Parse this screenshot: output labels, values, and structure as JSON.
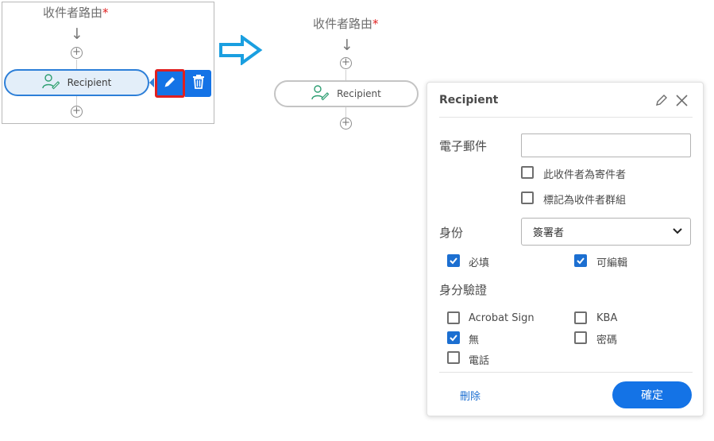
{
  "left_snippet": {
    "title": "收件者路由",
    "required_mark": "*",
    "node_label": "Recipient"
  },
  "right_flow": {
    "title": "收件者路由",
    "required_mark": "*",
    "node_label": "Recipient"
  },
  "panel": {
    "title": "Recipient",
    "email_label": "電子郵件",
    "email_value": "",
    "checkbox_sender": {
      "label": "此收件者為寄件者",
      "checked": false
    },
    "checkbox_group": {
      "label": "標記為收件者群組",
      "checked": false
    },
    "role_label": "身份",
    "role_value": "簽署者",
    "required_cb": {
      "label": "必填",
      "checked": true
    },
    "editable_cb": {
      "label": "可編輯",
      "checked": true
    },
    "auth_label": "身分驗證",
    "auth_options": [
      {
        "label": "Acrobat Sign",
        "checked": false
      },
      {
        "label": "KBA",
        "checked": false
      },
      {
        "label": "無",
        "checked": true
      },
      {
        "label": "密碼",
        "checked": false
      },
      {
        "label": "電話",
        "checked": false
      }
    ],
    "delete_label": "刪除",
    "confirm_label": "確定"
  },
  "colors": {
    "accent": "#1473e6",
    "highlight_red": "#e02020",
    "recipient_icon_green": "#2e9e72",
    "arrow_blue": "#1a9fe0"
  },
  "icons": {
    "recipient": "person-pen-icon",
    "edit": "pencil-icon",
    "delete": "trash-icon",
    "close": "close-icon",
    "add": "plus-circle-icon",
    "flow_arrow": "arrow-down-icon",
    "transition": "arrow-right-icon"
  }
}
